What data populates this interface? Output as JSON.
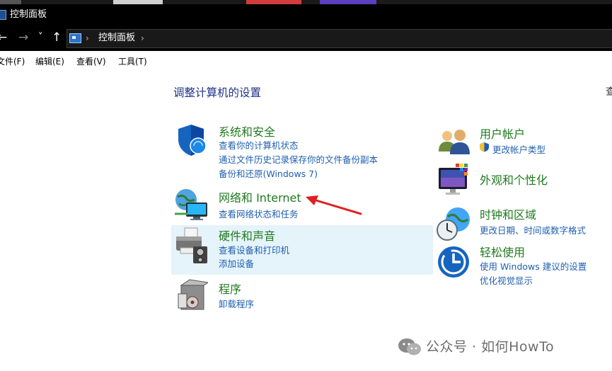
{
  "window": {
    "title": "控制面板"
  },
  "nav": {
    "back": "←",
    "forward": "→",
    "recent": "˅",
    "up": "↑"
  },
  "address": {
    "sep1": "›",
    "crumb": "控制面板",
    "sep2": "›"
  },
  "menu": {
    "file": "文件(F)",
    "edit": "编辑(E)",
    "view": "查看(V)",
    "tools": "工具(T)"
  },
  "main": {
    "heading": "调整计算机的设置",
    "view_clip": "查",
    "left": [
      {
        "title": "系统和安全",
        "links": [
          "查看你的计算机状态",
          "通过文件历史记录保存你的文件备份副本",
          "备份和还原(Windows 7)"
        ]
      },
      {
        "title": "网络和 Internet",
        "links": [
          "查看网络状态和任务"
        ]
      },
      {
        "title": "硬件和声音",
        "links": [
          "查看设备和打印机",
          "添加设备"
        ]
      },
      {
        "title": "程序",
        "links": [
          "卸载程序"
        ]
      }
    ],
    "right": [
      {
        "title": "用户帐户",
        "links": [
          "更改帐户类型"
        ]
      },
      {
        "title": "外观和个性化",
        "links": []
      },
      {
        "title": "时钟和区域",
        "links": [
          "更改日期、时间或数字格式"
        ]
      },
      {
        "title": "轻松使用",
        "links": [
          "使用 Windows 建议的设置",
          "优化视觉显示"
        ]
      }
    ]
  },
  "watermark": {
    "text": "公众号 · 如何HowTo"
  },
  "colors": {
    "title_green": "#1f7a1f",
    "link_blue": "#1f5fb0",
    "heading_blue": "#1e3287",
    "hover_bg": "#e5f3fb",
    "arrow_red": "#e02020"
  }
}
